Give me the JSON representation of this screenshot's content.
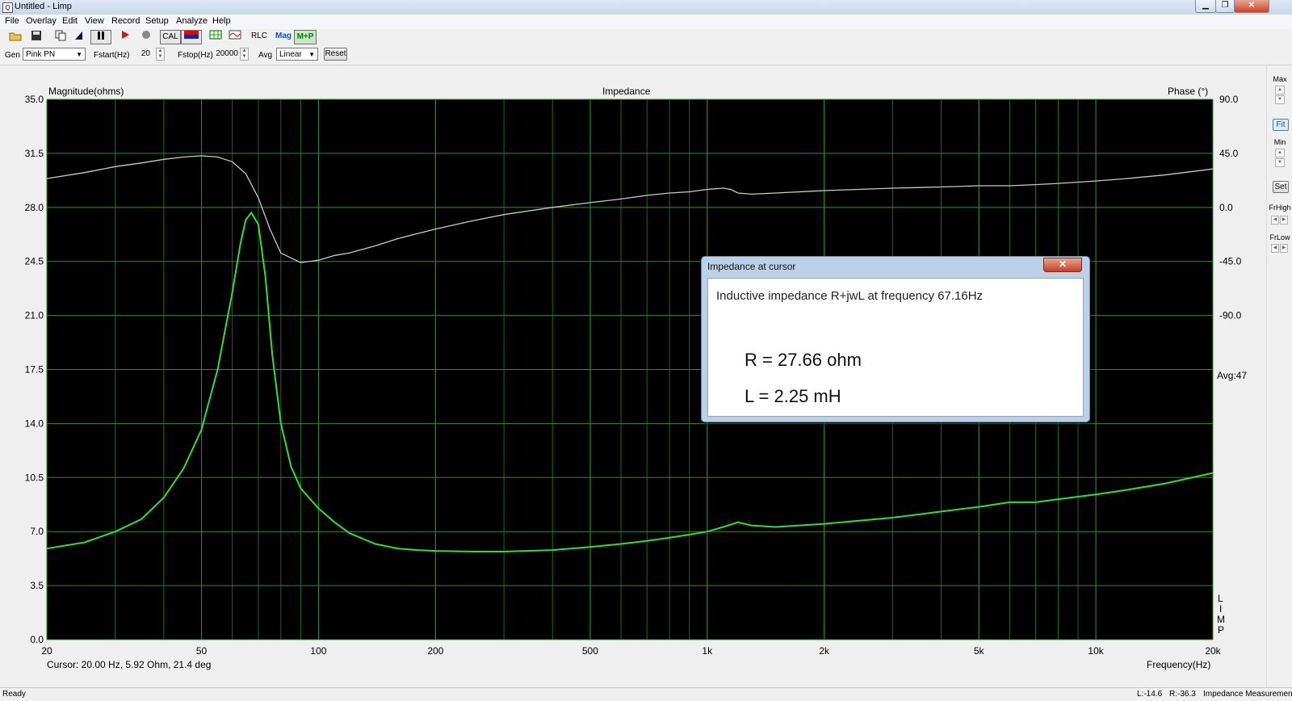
{
  "window": {
    "title": "Untitled - Limp",
    "app_icon_glyph": "Q"
  },
  "menu": [
    "File",
    "Overlay",
    "Edit",
    "View",
    "Record",
    "Setup",
    "Analyze",
    "Help"
  ],
  "toolbar": {
    "cal": "CAL",
    "rlc": "RLC",
    "mag": "Mag",
    "mp": "M+P"
  },
  "params": {
    "gen_label": "Gen",
    "gen_value": "Pink PN",
    "fstart_label": "Fstart(Hz)",
    "fstart_value": "20",
    "fstop_label": "Fstop(Hz)",
    "fstop_value": "20000",
    "avg_label": "Avg",
    "avg_value": "Linear",
    "reset": "Reset"
  },
  "plot": {
    "title": "Impedance",
    "left_label": "Magnitude(ohms)",
    "right_label": "Phase (°)",
    "x_label": "Frequency(Hz)",
    "cursor": "Cursor: 20.00 Hz, 5.92 Ohm, 21.4 deg",
    "avg_marker": "Avg:47",
    "vertical_tag": [
      "L",
      "I",
      "M",
      "P"
    ]
  },
  "chart_data": {
    "type": "line",
    "title": "Impedance",
    "xlabel": "Frequency(Hz)",
    "ylabel": "Magnitude(ohms)",
    "y2label": "Phase (°)",
    "xscale": "log",
    "xlim": [
      20,
      20000
    ],
    "ylim": [
      0,
      35
    ],
    "y2lim": [
      -90,
      90
    ],
    "x_ticks": [
      "20",
      "50",
      "100",
      "200",
      "500",
      "1k",
      "2k",
      "5k",
      "10k",
      "20k"
    ],
    "y_ticks": [
      "35.0",
      "31.5",
      "28.0",
      "24.5",
      "21.0",
      "17.5",
      "14.0",
      "10.5",
      "7.0",
      "3.5",
      "0.0"
    ],
    "y2_ticks": [
      "90.0",
      "45.0",
      "0.0",
      "-45.0",
      "-90.0"
    ],
    "grid": true,
    "background": "#000000",
    "series": [
      {
        "name": "Magnitude",
        "color": "#33dd33",
        "x": [
          20,
          25,
          30,
          35,
          40,
          45,
          50,
          55,
          60,
          63,
          65,
          67.16,
          70,
          73,
          76,
          80,
          85,
          90,
          100,
          110,
          120,
          140,
          160,
          180,
          200,
          250,
          300,
          400,
          500,
          600,
          700,
          800,
          900,
          1000,
          1100,
          1200,
          1300,
          1500,
          2000,
          3000,
          4000,
          5000,
          6000,
          7000,
          8000,
          10000,
          12000,
          15000,
          20000
        ],
        "y": [
          5.9,
          6.3,
          7.0,
          7.8,
          9.2,
          11.1,
          13.6,
          17.5,
          22.5,
          25.7,
          27.2,
          27.66,
          26.9,
          23.5,
          18.5,
          14.0,
          11.2,
          9.8,
          8.5,
          7.6,
          6.9,
          6.2,
          5.9,
          5.8,
          5.75,
          5.7,
          5.7,
          5.8,
          6.0,
          6.2,
          6.4,
          6.6,
          6.8,
          7.0,
          7.3,
          7.6,
          7.4,
          7.3,
          7.5,
          7.9,
          8.3,
          8.6,
          8.9,
          8.9,
          9.1,
          9.4,
          9.7,
          10.1,
          10.8
        ]
      },
      {
        "name": "Phase",
        "color": "#c8c8c8",
        "x": [
          20,
          25,
          30,
          35,
          40,
          45,
          50,
          55,
          60,
          65,
          70,
          75,
          80,
          90,
          100,
          110,
          120,
          140,
          160,
          200,
          250,
          300,
          400,
          500,
          600,
          700,
          800,
          900,
          1000,
          1100,
          1150,
          1200,
          1300,
          1500,
          2000,
          3000,
          4000,
          5000,
          6000,
          7000,
          8000,
          10000,
          12000,
          15000,
          20000
        ],
        "y": [
          24,
          29,
          34,
          37,
          40,
          42,
          43,
          42,
          38,
          28,
          8,
          -18,
          -38,
          -46,
          -44,
          -40,
          -38,
          -32,
          -26,
          -18,
          -11,
          -6,
          0,
          4,
          7,
          10,
          12,
          13,
          15,
          16,
          15,
          12,
          11,
          12,
          14,
          16,
          17,
          18,
          18,
          19,
          20,
          22,
          24,
          27,
          32
        ]
      }
    ]
  },
  "dialog": {
    "title": "Impedance at cursor",
    "line1": "Inductive impedance R+jwL at frequency 67.16Hz",
    "r": "R = 27.66 ohm",
    "l": "L = 2.25 mH",
    "close_glyph": "✕"
  },
  "right_panel": {
    "max": "Max",
    "fit": "Fit",
    "min": "Min",
    "set": "Set",
    "frhigh": "FrHigh",
    "frlow": "FrLow"
  },
  "status": {
    "left": "Ready",
    "l": "L:-14.6",
    "r": "R:-36.3",
    "mode": "Impedance Measuremen"
  }
}
